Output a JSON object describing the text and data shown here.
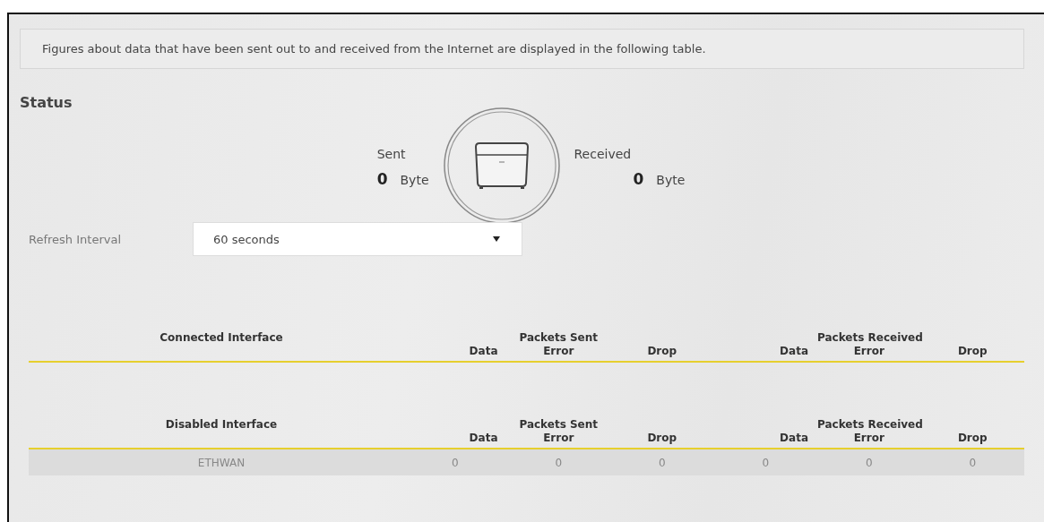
{
  "description": "Figures about data that have been sent out to and received from the Internet are displayed in the following table.",
  "status": {
    "title": "Status",
    "sent": {
      "label": "Sent",
      "value": "0",
      "unit": "Byte"
    },
    "received": {
      "label": "Received",
      "value": "0",
      "unit": "Byte"
    }
  },
  "refresh_interval": {
    "label": "Refresh Interval",
    "value": "60 seconds"
  },
  "tables": [
    {
      "groups": [
        "Packets Sent",
        "Packets Received"
      ],
      "columns": [
        "Connected Interface",
        "Data",
        "Error",
        "Drop",
        "Data",
        "Error",
        "Drop"
      ]
    },
    {
      "groups": [
        "Packets Sent",
        "Packets Received"
      ],
      "columns": [
        "Disabled Interface",
        "Data",
        "Error",
        "Drop",
        "Data",
        "Error",
        "Drop"
      ],
      "rows": [
        [
          "ETHWAN",
          "0",
          "0",
          "0",
          "0",
          "0",
          "0"
        ]
      ]
    }
  ]
}
